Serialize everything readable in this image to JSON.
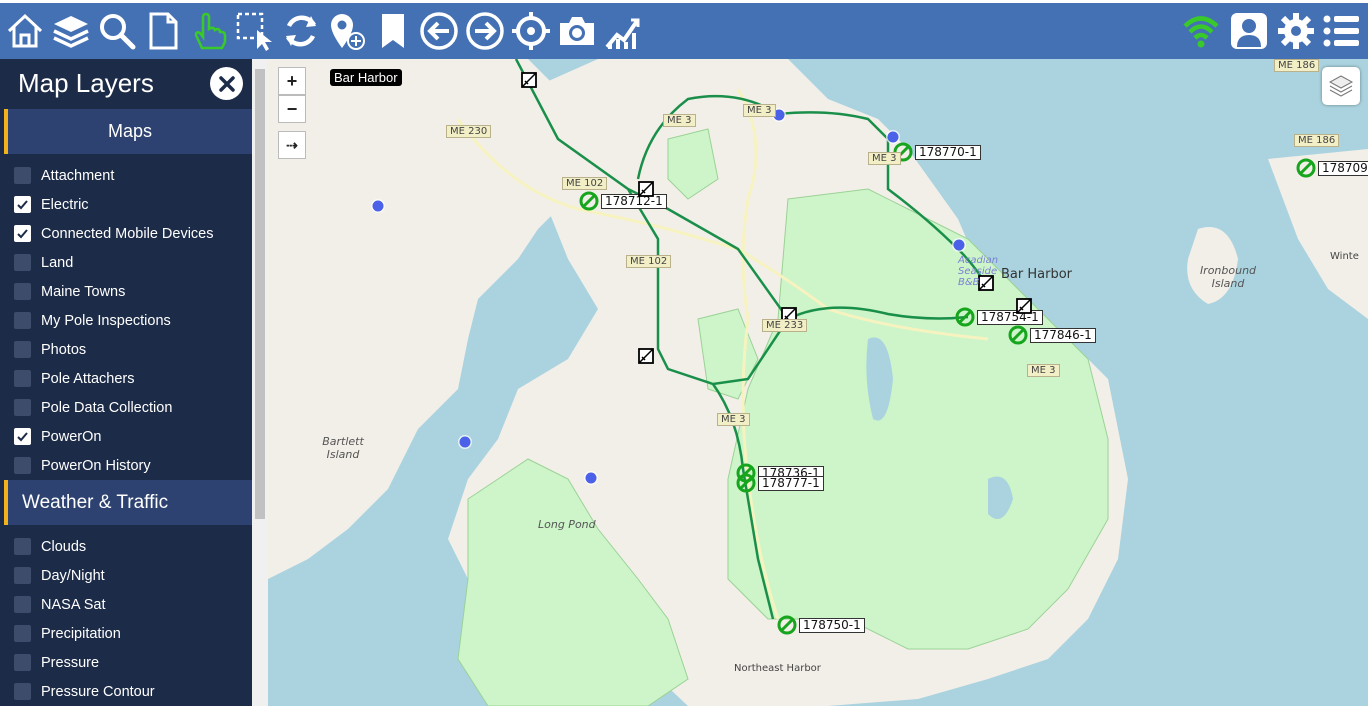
{
  "toolbar": {
    "left_icons": [
      "home-icon",
      "layers-icon",
      "search-icon",
      "document-icon",
      "hand-pointer-icon",
      "select-area-icon",
      "refresh-icon",
      "add-location-icon",
      "bookmark-icon",
      "back-arrow-icon",
      "forward-arrow-icon",
      "crosshair-icon",
      "camera-icon",
      "chart-icon"
    ],
    "right_icons": [
      "wifi-icon",
      "user-icon",
      "gear-icon",
      "list-icon"
    ],
    "bg_color": "#4470b4",
    "wifi_color": "#39c92b"
  },
  "sidebar": {
    "title": "Map Layers",
    "sections": [
      {
        "label": "Maps",
        "items": [
          {
            "label": "Attachment",
            "checked": false
          },
          {
            "label": "Electric",
            "checked": true
          },
          {
            "label": "Connected Mobile Devices",
            "checked": true
          },
          {
            "label": "Land",
            "checked": false
          },
          {
            "label": "Maine Towns",
            "checked": false
          },
          {
            "label": "My Pole Inspections",
            "checked": false
          },
          {
            "label": "Photos",
            "checked": false
          },
          {
            "label": "Pole Attachers",
            "checked": false
          },
          {
            "label": "Pole Data Collection",
            "checked": false
          },
          {
            "label": "PowerOn",
            "checked": true
          },
          {
            "label": "PowerOn History",
            "checked": false
          }
        ]
      },
      {
        "label": "Weather & Traffic",
        "items": [
          {
            "label": "Clouds",
            "checked": false
          },
          {
            "label": "Day/Night",
            "checked": false
          },
          {
            "label": "NASA Sat",
            "checked": false
          },
          {
            "label": "Precipitation",
            "checked": false
          },
          {
            "label": "Pressure",
            "checked": false
          },
          {
            "label": "Pressure Contour",
            "checked": false
          }
        ]
      }
    ]
  },
  "map": {
    "zoom_in": "+",
    "zoom_out": "−",
    "arrow_btn": "⇢",
    "place_label": "Bar Harbor",
    "outage_labels": [
      "178770-1",
      "178709",
      "178712-1",
      "178754-1",
      "177846-1",
      "178736-1",
      "178777-1",
      "178750-1"
    ],
    "place_names": [
      "Bar Harbor",
      "Ironbound Island",
      "Bartlett Island",
      "Long Pond",
      "Northeast Harbor",
      "Acadian Seaside B&B",
      "Winte"
    ],
    "road_labels": [
      "ME 230",
      "ME 3",
      "ME 102",
      "ME 102",
      "ME 233",
      "ME 3",
      "ME 3",
      "ME 186",
      "ME 186",
      "ME 3",
      "ME 3"
    ]
  }
}
